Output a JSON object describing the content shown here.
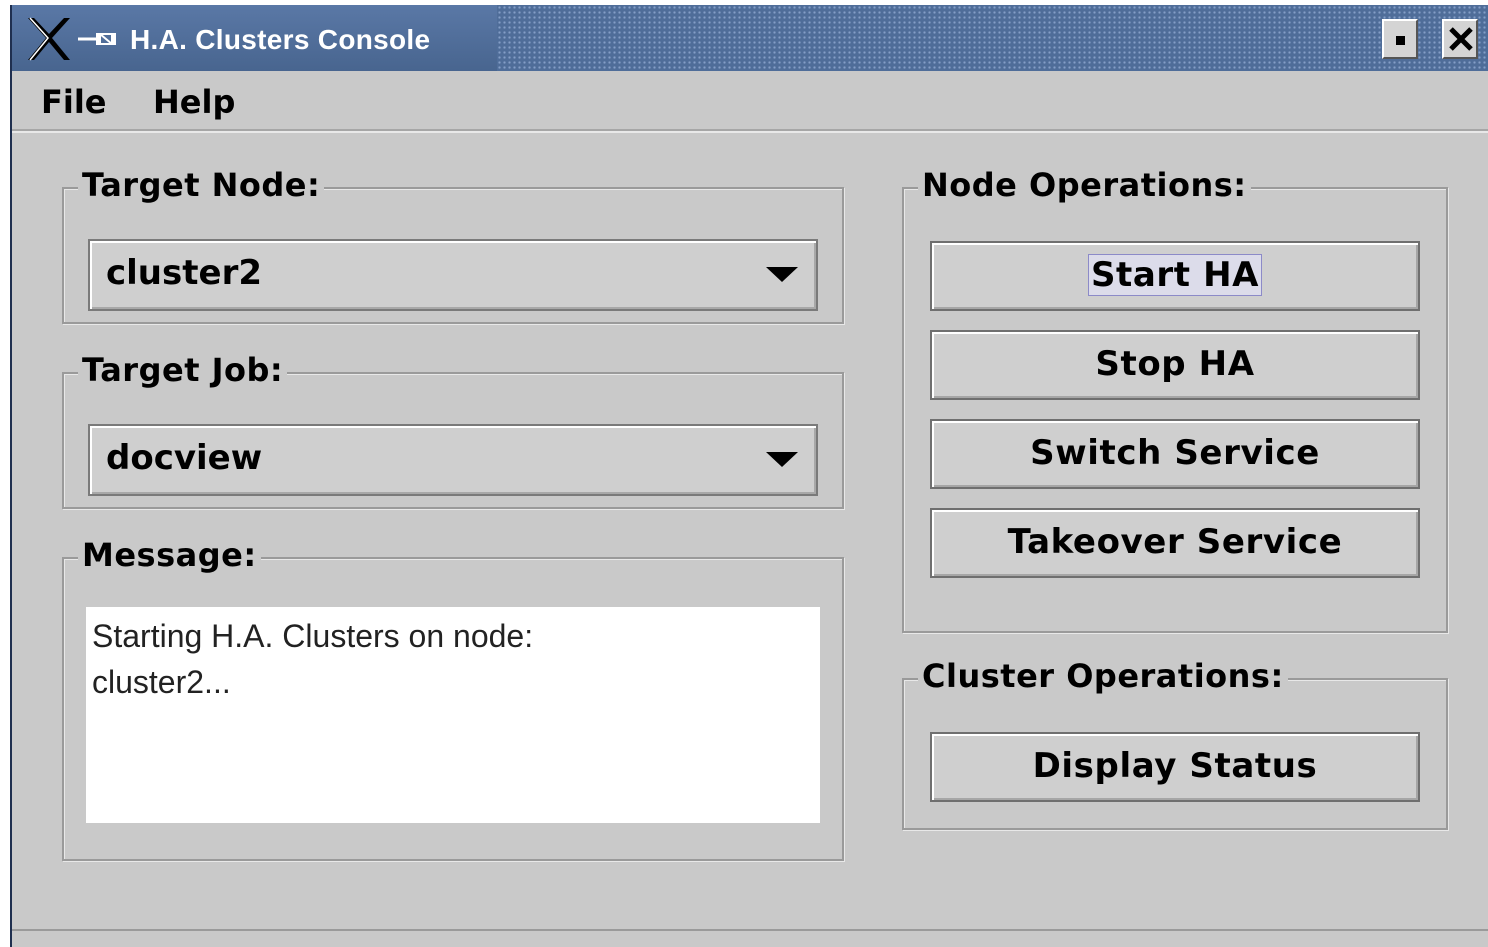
{
  "window": {
    "title": "H.A. Clusters Console",
    "buttons": {
      "minimize": "minimize-icon",
      "close": "close-icon"
    }
  },
  "menu": {
    "file": "File",
    "help": "Help"
  },
  "target_node": {
    "label": "Target Node:",
    "value": "cluster2"
  },
  "target_job": {
    "label": "Target Job:",
    "value": "docview"
  },
  "message": {
    "label": "Message:",
    "text": "Starting H.A. Clusters on node:\ncluster2..."
  },
  "node_operations": {
    "label": "Node Operations:",
    "start_ha": "Start HA",
    "stop_ha": "Stop HA",
    "switch_service": "Switch Service",
    "takeover_service": "Takeover Service"
  },
  "cluster_operations": {
    "label": "Cluster Operations:",
    "display_status": "Display Status"
  },
  "colors": {
    "titlebar": "#4f6d99",
    "window_bg": "#c9c9c9",
    "focus_ring": "#8c8ac8"
  }
}
